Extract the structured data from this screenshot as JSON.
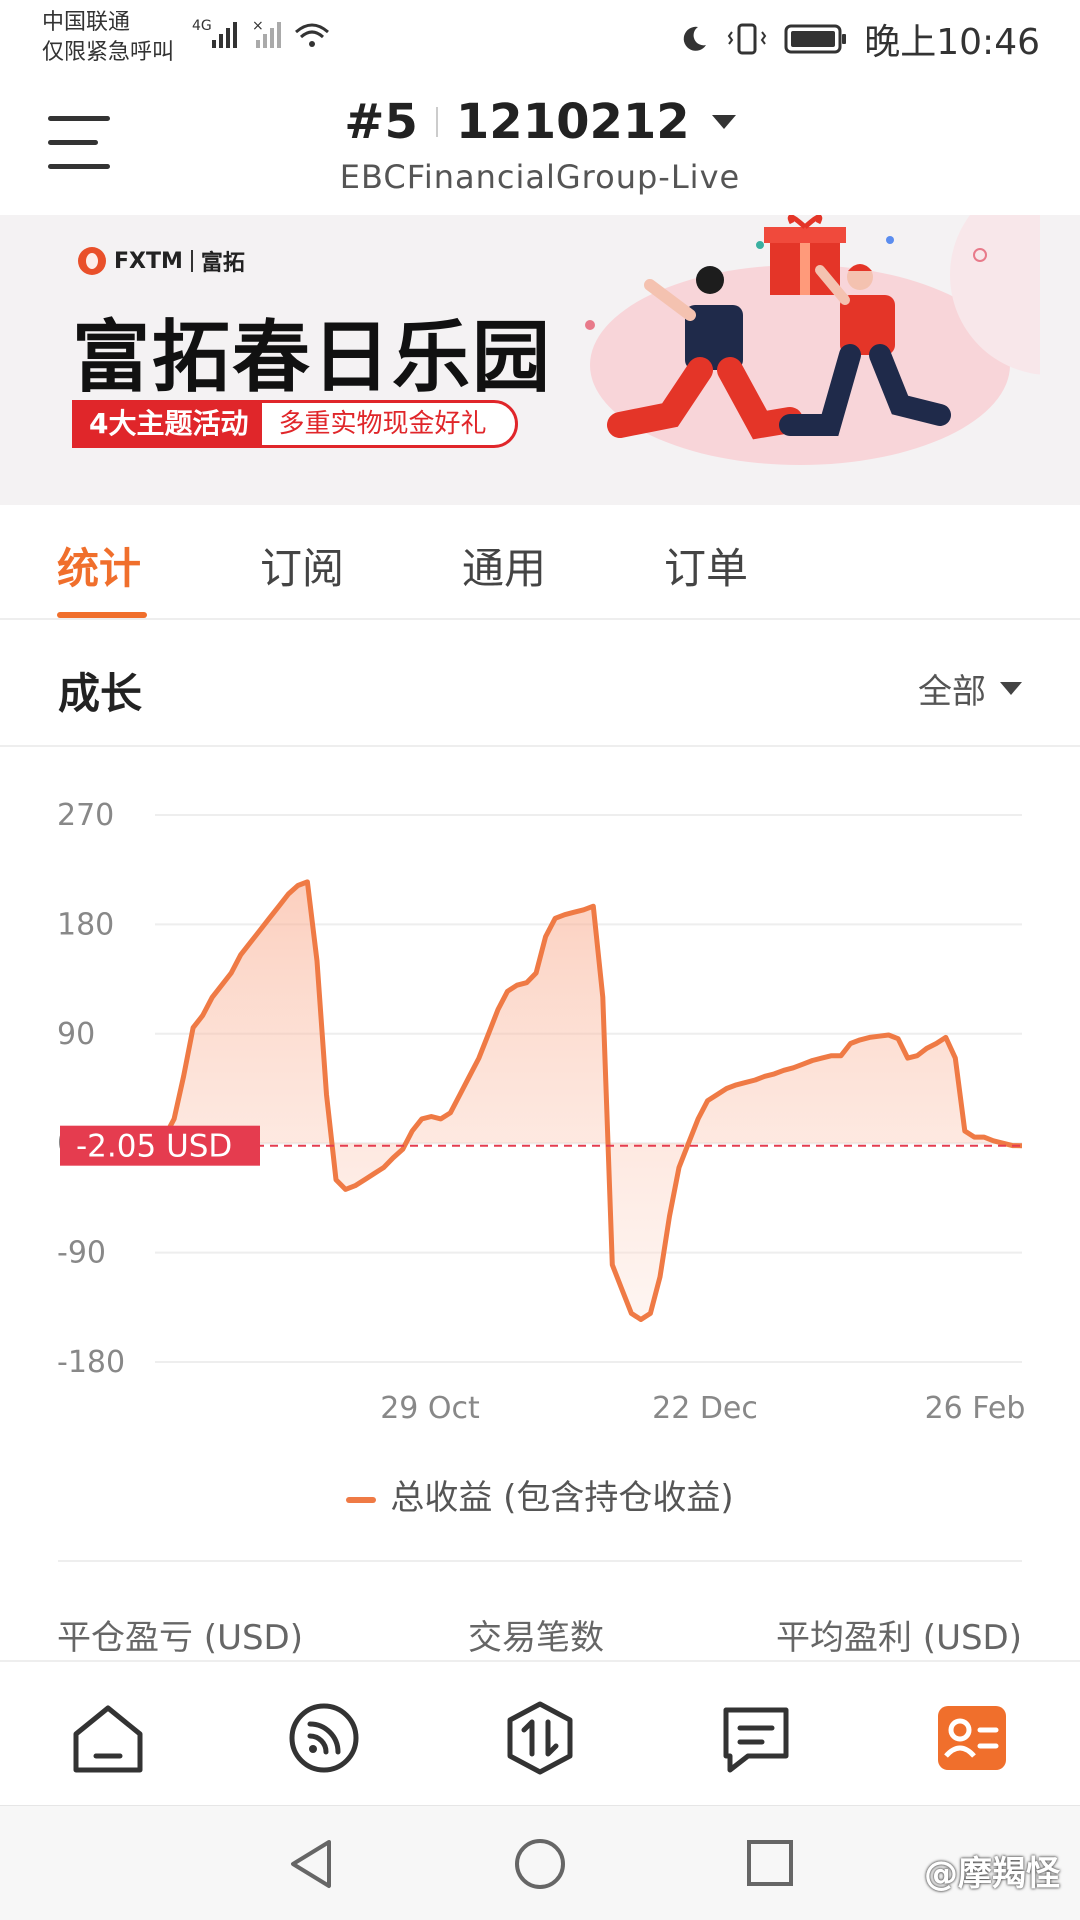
{
  "status_bar": {
    "carrier_line1": "中国联通",
    "carrier_line2": "仅限紧急呼叫",
    "net_type": "4G",
    "time": "晚上10:46"
  },
  "header": {
    "account_index": "#5",
    "account_number": "1210212",
    "server": "EBCFinancialGroup-Live"
  },
  "banner": {
    "brand": "FXTM",
    "brand_cn": "富拓",
    "title": "富拓春日乐园",
    "tag_left": "4大主题活动",
    "tag_right": "多重实物现金好礼"
  },
  "tabs": [
    {
      "label": "统计",
      "active": true
    },
    {
      "label": "订阅",
      "active": false
    },
    {
      "label": "通用",
      "active": false
    },
    {
      "label": "订单",
      "active": false
    }
  ],
  "section": {
    "title": "成长",
    "range": "全部"
  },
  "chart_data": {
    "type": "area",
    "title": "",
    "xlabel": "",
    "ylabel": "",
    "ylim": [
      -180,
      270
    ],
    "yticks": [
      "270",
      "180",
      "90",
      "0",
      "-90",
      "-180"
    ],
    "xticks": [
      "29 Oct",
      "22 Dec",
      "26 Feb"
    ],
    "current_value_label": "-2.05 USD",
    "legend_placement": "bottom",
    "grid": true,
    "series": [
      {
        "name": "总收益 (包含持仓收益)",
        "color": "#ef7a45",
        "values": [
          0,
          5,
          20,
          55,
          95,
          105,
          120,
          130,
          140,
          155,
          165,
          175,
          185,
          195,
          205,
          212,
          215,
          150,
          40,
          -30,
          -38,
          -35,
          -30,
          -25,
          -20,
          -12,
          -5,
          10,
          20,
          22,
          20,
          25,
          40,
          55,
          70,
          90,
          110,
          125,
          130,
          132,
          140,
          170,
          185,
          188,
          190,
          192,
          195,
          120,
          -100,
          -120,
          -140,
          -145,
          -140,
          -110,
          -60,
          -20,
          0,
          20,
          35,
          40,
          45,
          48,
          50,
          52,
          55,
          57,
          60,
          62,
          65,
          68,
          70,
          72,
          72,
          82,
          85,
          87,
          88,
          89,
          86,
          70,
          72,
          78,
          82,
          87,
          70,
          10,
          5,
          5,
          2,
          0,
          -2,
          -2.05
        ]
      }
    ]
  },
  "stats": {
    "closed_pnl_label": "平仓盈亏 (USD)",
    "trades_label": "交易笔数",
    "avg_profit_label": "平均盈利 (USD)"
  },
  "watermark": "@摩羯怪",
  "colors": {
    "accent": "#f06f2c",
    "line": "#ef7a45",
    "marker": "#e53c4f",
    "banner_red": "#e0262a"
  }
}
